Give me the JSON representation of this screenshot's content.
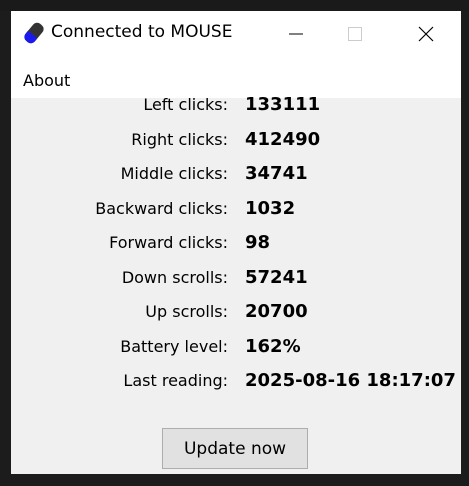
{
  "window": {
    "title": "Connected to MOUSE",
    "icon": "mouse-icon"
  },
  "menu": {
    "items": [
      {
        "label": "About"
      }
    ]
  },
  "stats": [
    {
      "label": "Left clicks:",
      "value": "133111"
    },
    {
      "label": "Right clicks:",
      "value": "412490"
    },
    {
      "label": "Middle clicks:",
      "value": "34741"
    },
    {
      "label": "Backward clicks:",
      "value": "1032"
    },
    {
      "label": "Forward clicks:",
      "value": "98"
    },
    {
      "label": "Down scrolls:",
      "value": "57241"
    },
    {
      "label": "Up scrolls:",
      "value": "20700"
    },
    {
      "label": "Battery level:",
      "value": "162%"
    },
    {
      "label": "Last reading:",
      "value": "2025-08-16 18:17:07"
    }
  ],
  "actions": {
    "update_label": "Update now"
  }
}
